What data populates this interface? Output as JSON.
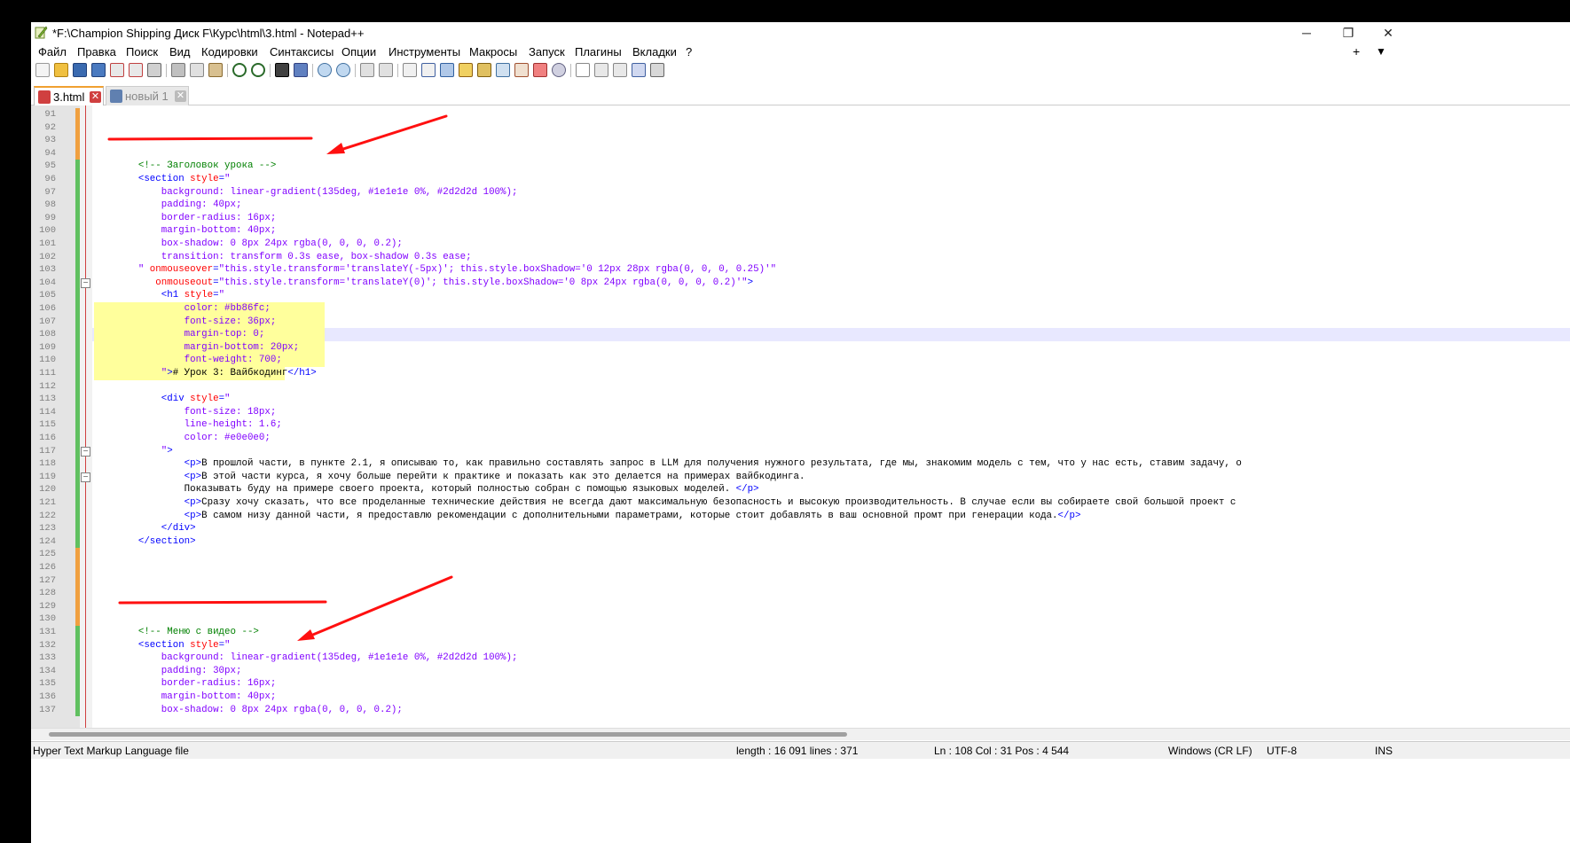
{
  "window": {
    "title": "*F:\\Champion Shipping Диск F\\Курс\\html\\3.html - Notepad++",
    "minimize": "─",
    "restore": "❐",
    "close": "✕"
  },
  "menu": {
    "items": [
      "Файл",
      "Правка",
      "Поиск",
      "Вид",
      "Кодировки",
      "Синтаксисы",
      "Опции",
      "Инструменты",
      "Макросы",
      "Запуск",
      "Плагины",
      "Вкладки",
      "?"
    ],
    "new_tab": "+",
    "dropdown": "▼"
  },
  "tabs": [
    {
      "label": "3.html",
      "active": true
    },
    {
      "label": "новый 1",
      "active": false
    }
  ],
  "editor": {
    "first_line": 91,
    "current_line": 108,
    "lines": [
      [],
      [],
      [],
      [],
      [
        [
          "c-cmt",
          "        <!-- Заголовок урока -->"
        ]
      ],
      [
        [
          "c-tag",
          "        <section "
        ],
        [
          "c-attr",
          "style"
        ],
        [
          "c-tag",
          "="
        ],
        [
          "c-val",
          "\""
        ]
      ],
      [
        [
          "c-val",
          "            background: linear-gradient(135deg, #1e1e1e 0%, #2d2d2d 100%);"
        ]
      ],
      [
        [
          "c-val",
          "            padding: 40px;"
        ]
      ],
      [
        [
          "c-val",
          "            border-radius: 16px;"
        ]
      ],
      [
        [
          "c-val",
          "            margin-bottom: 40px;"
        ]
      ],
      [
        [
          "c-val",
          "            box-shadow: 0 8px 24px rgba(0, 0, 0, 0.2);"
        ]
      ],
      [
        [
          "c-val",
          "            transition: transform 0.3s ease, box-shadow 0.3s ease;"
        ]
      ],
      [
        [
          "c-val",
          "        \" "
        ],
        [
          "c-attr",
          "onmouseover"
        ],
        [
          "c-tag",
          "="
        ],
        [
          "c-val",
          "\"this.style.transform='translateY(-5px)'; this.style.boxShadow='0 12px 28px rgba(0, 0, 0, 0.25)'\""
        ]
      ],
      [
        [
          "c-attr",
          "           onmouseout"
        ],
        [
          "c-tag",
          "="
        ],
        [
          "c-val",
          "\"this.style.transform='translateY(0)'; this.style.boxShadow='0 8px 24px rgba(0, 0, 0, 0.2)'\""
        ],
        [
          "c-tag",
          ">"
        ]
      ],
      [
        [
          "c-tag",
          "            <h1 "
        ],
        [
          "c-attr",
          "style"
        ],
        [
          "c-tag",
          "="
        ],
        [
          "c-val",
          "\""
        ]
      ],
      [
        [
          "c-val",
          "                color: #bb86fc;"
        ]
      ],
      [
        [
          "c-val",
          "                font-size: 36px;"
        ]
      ],
      [
        [
          "c-val",
          "                margin-top: 0;"
        ]
      ],
      [
        [
          "c-val",
          "                margin-bottom: 20px;"
        ]
      ],
      [
        [
          "c-val",
          "                font-weight: 700;"
        ]
      ],
      [
        [
          "c-val",
          "            \""
        ],
        [
          "c-tag",
          ">"
        ],
        [
          "c-txt",
          "# Урок 3: Вайбкодинг"
        ],
        [
          "c-tag",
          "</h1>"
        ]
      ],
      [],
      [
        [
          "c-tag",
          "            <div "
        ],
        [
          "c-attr",
          "style"
        ],
        [
          "c-tag",
          "="
        ],
        [
          "c-val",
          "\""
        ]
      ],
      [
        [
          "c-val",
          "                font-size: 18px;"
        ]
      ],
      [
        [
          "c-val",
          "                line-height: 1.6;"
        ]
      ],
      [
        [
          "c-val",
          "                color: #e0e0e0;"
        ]
      ],
      [
        [
          "c-val",
          "            \""
        ],
        [
          "c-tag",
          ">"
        ]
      ],
      [
        [
          "c-tag",
          "                <p>"
        ],
        [
          "c-txt",
          "В прошлой части, в пункте 2.1, я описываю то, как правильно составлять запрос в LLM для получения нужного результата, где мы, знакомим модель с тем, что у нас есть, ставим задачу, о"
        ]
      ],
      [
        [
          "c-tag",
          "                <p>"
        ],
        [
          "c-txt",
          "В этой части курса, я хочу больше перейти к практике и показать как это делается на примерах вайбкодинга."
        ]
      ],
      [
        [
          "c-txt",
          "                Показывать буду на примере своего проекта, который полностью собран с помощью языковых моделей. "
        ],
        [
          "c-tag",
          "</p>"
        ]
      ],
      [
        [
          "c-tag",
          "                <p>"
        ],
        [
          "c-txt",
          "Сразу хочу сказать, что все проделанные технические действия не всегда дают максимальную безопасность и высокую производительность. В случае если вы собираете свой большой проект с"
        ]
      ],
      [
        [
          "c-tag",
          "                <p>"
        ],
        [
          "c-txt",
          "В самом низу данной части, я предоставлю рекомендации с дополнительными параметрами, которые стоит добавлять в ваш основной промт при генерации кода."
        ],
        [
          "c-tag",
          "</p>"
        ]
      ],
      [
        [
          "c-tag",
          "            </div>"
        ]
      ],
      [
        [
          "c-tag",
          "        </section>"
        ]
      ],
      [],
      [],
      [],
      [],
      [],
      [],
      [
        [
          "c-cmt",
          "        <!-- Меню с видео -->"
        ]
      ],
      [
        [
          "c-tag",
          "        <section "
        ],
        [
          "c-attr",
          "style"
        ],
        [
          "c-tag",
          "="
        ],
        [
          "c-val",
          "\""
        ]
      ],
      [
        [
          "c-val",
          "            background: linear-gradient(135deg, #1e1e1e 0%, #2d2d2d 100%);"
        ]
      ],
      [
        [
          "c-val",
          "            padding: 30px;"
        ]
      ],
      [
        [
          "c-val",
          "            border-radius: 16px;"
        ]
      ],
      [
        [
          "c-val",
          "            margin-bottom: 40px;"
        ]
      ],
      [
        [
          "c-val",
          "            box-shadow: 0 8px 24px rgba(0, 0, 0, 0.2);"
        ]
      ]
    ]
  },
  "status": {
    "filetype": "Hyper Text Markup Language file",
    "length": "length : 16 091    lines : 371",
    "position": "Ln : 108    Col : 31    Pos : 4 544",
    "eol": "Windows (CR LF)",
    "encoding": "UTF-8",
    "mode": "INS"
  }
}
